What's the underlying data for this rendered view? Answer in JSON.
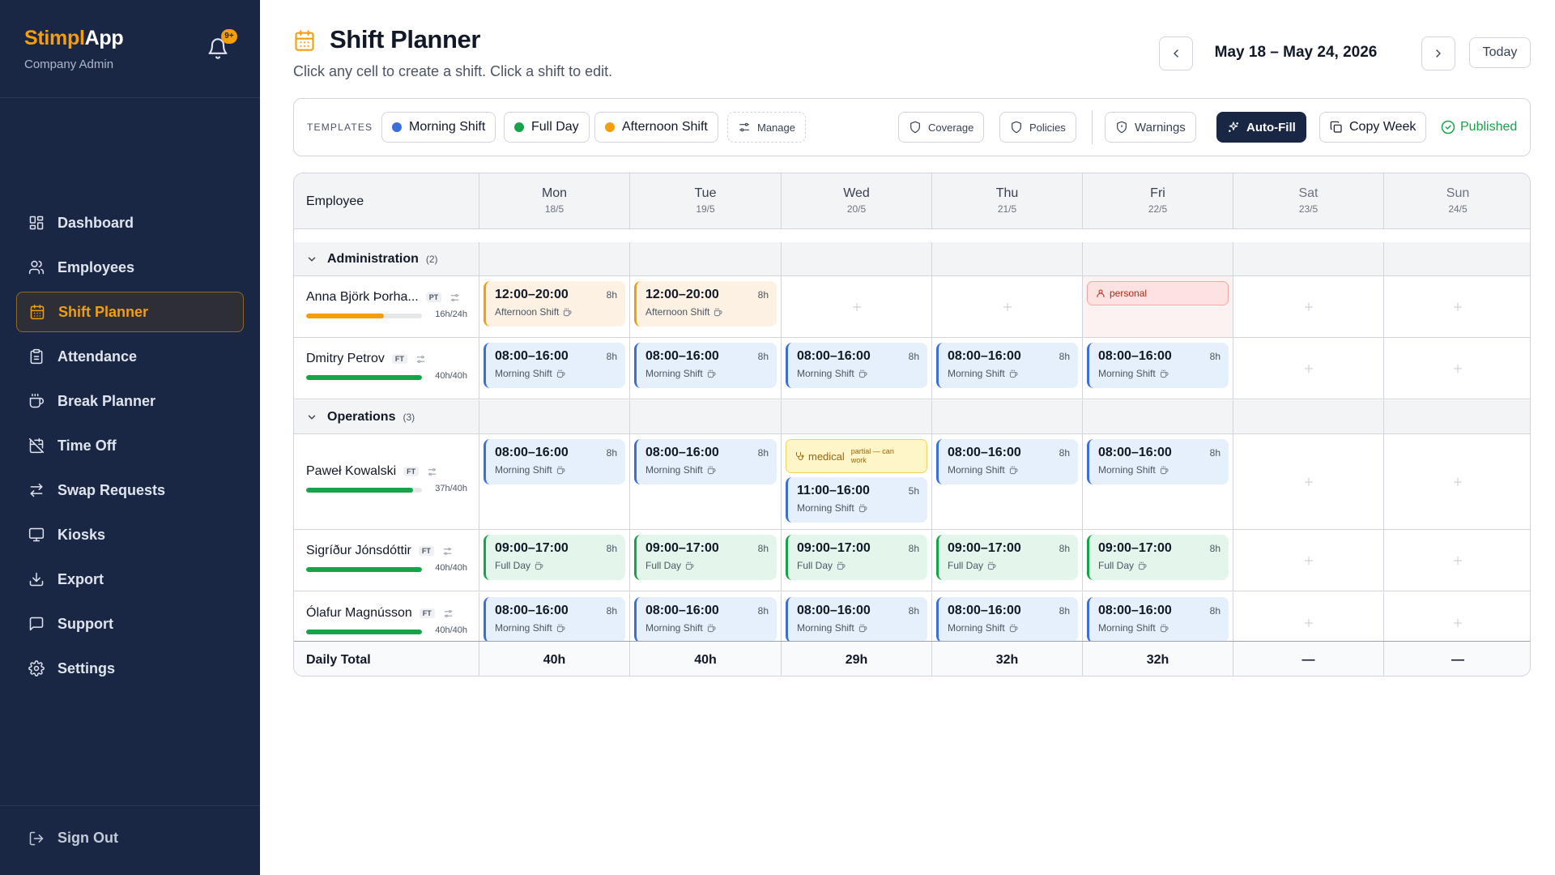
{
  "sidebar": {
    "brand_a": "Stimpl",
    "brand_b": "App",
    "role": "Company Admin",
    "notification_badge": "9+",
    "items": [
      {
        "label": "Dashboard",
        "icon": "dashboard-icon",
        "active": false
      },
      {
        "label": "Employees",
        "icon": "users-icon",
        "active": false
      },
      {
        "label": "Shift Planner",
        "icon": "calendar-icon",
        "active": true
      },
      {
        "label": "Attendance",
        "icon": "clipboard-icon",
        "active": false
      },
      {
        "label": "Break Planner",
        "icon": "coffee-icon",
        "active": false
      },
      {
        "label": "Time Off",
        "icon": "calendar-off-icon",
        "active": false
      },
      {
        "label": "Swap Requests",
        "icon": "swap-icon",
        "active": false
      },
      {
        "label": "Kiosks",
        "icon": "monitor-icon",
        "active": false
      },
      {
        "label": "Export",
        "icon": "download-icon",
        "active": false
      },
      {
        "label": "Support",
        "icon": "chat-icon",
        "active": false
      },
      {
        "label": "Settings",
        "icon": "gear-icon",
        "active": false
      }
    ],
    "signout": "Sign Out"
  },
  "header": {
    "title": "Shift Planner",
    "subtitle": "Click any cell to create a shift. Click a shift to edit.",
    "date_range": "May 18 – May 24, 2026",
    "today": "Today"
  },
  "toolbar": {
    "templates_label": "TEMPLATES",
    "templates": [
      {
        "label": "Morning Shift",
        "color": "#3b6fd8"
      },
      {
        "label": "Full Day",
        "color": "#16a34a"
      },
      {
        "label": "Afternoon Shift",
        "color": "#f59e0b"
      }
    ],
    "manage": "Manage",
    "coverage": "Coverage",
    "policies": "Policies",
    "warnings": "Warnings",
    "autofill": "Auto-Fill",
    "copy_week": "Copy Week",
    "status": "Published"
  },
  "grid": {
    "employee_header": "Employee",
    "days": [
      {
        "name": "Mon",
        "date": "18/5"
      },
      {
        "name": "Tue",
        "date": "19/5"
      },
      {
        "name": "Wed",
        "date": "20/5"
      },
      {
        "name": "Thu",
        "date": "21/5"
      },
      {
        "name": "Fri",
        "date": "22/5"
      },
      {
        "name": "Sat",
        "date": "23/5"
      },
      {
        "name": "Sun",
        "date": "24/5"
      }
    ],
    "groups": [
      {
        "name": "Administration",
        "count": "(2)"
      },
      {
        "name": "Operations",
        "count": "(3)"
      }
    ],
    "employees": [
      {
        "name": "Anna Björk Þorha...",
        "tag": "PT",
        "hours": "16h/24h",
        "progress": 0.67,
        "bar_color": "#f59e0b",
        "cells": [
          {
            "time": "12:00–20:00",
            "hrs": "8h",
            "shift": "Afternoon Shift"
          },
          {
            "time": "12:00–20:00",
            "hrs": "8h",
            "shift": "Afternoon Shift"
          },
          {},
          {},
          {
            "absence": "personal"
          },
          {},
          {}
        ]
      },
      {
        "name": "Dmitry Petrov",
        "tag": "FT",
        "hours": "40h/40h",
        "progress": 1.0,
        "bar_color": "#16a34a",
        "cells": [
          {
            "time": "08:00–16:00",
            "hrs": "8h",
            "shift": "Morning Shift"
          },
          {
            "time": "08:00–16:00",
            "hrs": "8h",
            "shift": "Morning Shift"
          },
          {
            "time": "08:00–16:00",
            "hrs": "8h",
            "shift": "Morning Shift"
          },
          {
            "time": "08:00–16:00",
            "hrs": "8h",
            "shift": "Morning Shift"
          },
          {
            "time": "08:00–16:00",
            "hrs": "8h",
            "shift": "Morning Shift"
          },
          {},
          {}
        ]
      },
      {
        "name": "Paweł Kowalski",
        "tag": "FT",
        "hours": "37h/40h",
        "progress": 0.925,
        "bar_color": "#16a34a",
        "cells": [
          {
            "time": "08:00–16:00",
            "hrs": "8h",
            "shift": "Morning Shift"
          },
          {
            "time": "08:00–16:00",
            "hrs": "8h",
            "shift": "Morning Shift"
          },
          {
            "absence": "medical",
            "note": "partial — can work",
            "time": "11:00–16:00",
            "hrs": "5h",
            "shift": "Morning Shift"
          },
          {
            "time": "08:00–16:00",
            "hrs": "8h",
            "shift": "Morning Shift"
          },
          {
            "time": "08:00–16:00",
            "hrs": "8h",
            "shift": "Morning Shift"
          },
          {},
          {}
        ]
      },
      {
        "name": "Sigríður Jónsdóttir",
        "tag": "FT",
        "hours": "40h/40h",
        "progress": 1.0,
        "bar_color": "#16a34a",
        "cells": [
          {
            "time": "09:00–17:00",
            "hrs": "8h",
            "shift": "Full Day"
          },
          {
            "time": "09:00–17:00",
            "hrs": "8h",
            "shift": "Full Day"
          },
          {
            "time": "09:00–17:00",
            "hrs": "8h",
            "shift": "Full Day"
          },
          {
            "time": "09:00–17:00",
            "hrs": "8h",
            "shift": "Full Day"
          },
          {
            "time": "09:00–17:00",
            "hrs": "8h",
            "shift": "Full Day"
          },
          {},
          {}
        ]
      },
      {
        "name": "Ólafur Magnússon",
        "tag": "FT",
        "hours": "40h/40h",
        "progress": 1.0,
        "bar_color": "#16a34a",
        "cells": [
          {
            "time": "08:00–16:00",
            "hrs": "8h",
            "shift": "Morning Shift"
          },
          {
            "time": "08:00–16:00",
            "hrs": "8h",
            "shift": "Morning Shift"
          },
          {
            "time": "08:00–16:00",
            "hrs": "8h",
            "shift": "Morning Shift"
          },
          {
            "time": "08:00–16:00",
            "hrs": "8h",
            "shift": "Morning Shift"
          },
          {
            "time": "08:00–16:00",
            "hrs": "8h",
            "shift": "Morning Shift"
          },
          {},
          {}
        ]
      }
    ],
    "total_label": "Daily Total",
    "totals": [
      "40h",
      "40h",
      "29h",
      "32h",
      "32h",
      "—",
      "—"
    ]
  },
  "colors": {
    "sidebar_bg": "#1a2744",
    "accent": "#f59e0b",
    "morning": "#3b6fd8",
    "full_day": "#16a34a",
    "afternoon": "#f59e0b",
    "published": "#16a34a"
  }
}
